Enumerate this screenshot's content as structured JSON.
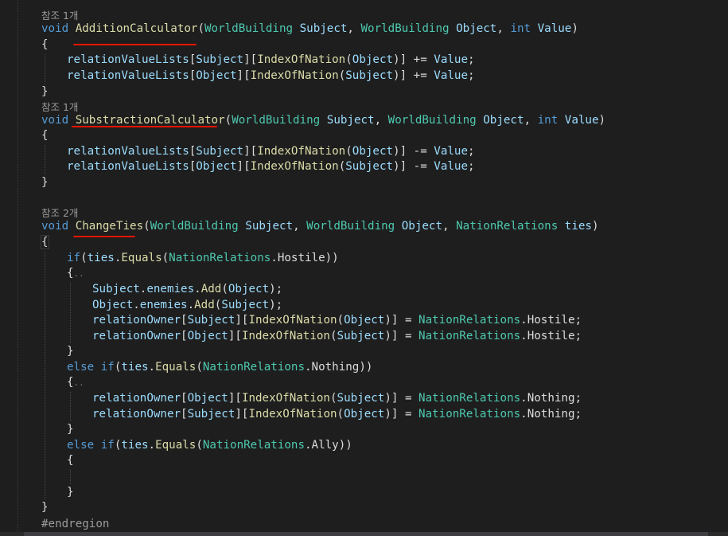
{
  "codelens": {
    "refs1": "참조 1개",
    "refs2": "참조 1개",
    "refs3": "참조 2개"
  },
  "code": {
    "void": "void",
    "int": "int",
    "if": "if",
    "else": "else",
    "world_building": "WorldBuilding",
    "nation_relations": "NationRelations",
    "addition_name": "AdditionCalculator",
    "subtraction_name": "SubstractionCalculator",
    "change_ties_name": "ChangeTies",
    "subject": "Subject",
    "object": "Object",
    "value": "Value",
    "ties": "ties",
    "relation_value_lists": "relationValueLists",
    "relation_owner": "relationOwner",
    "index_of_nation": "IndexOfNation",
    "equals": "Equals",
    "enemies": "enemies",
    "add": "Add",
    "hostile": "Hostile",
    "nothing": "Nothing",
    "ally": "Ally",
    "endregion": "#endregion"
  }
}
